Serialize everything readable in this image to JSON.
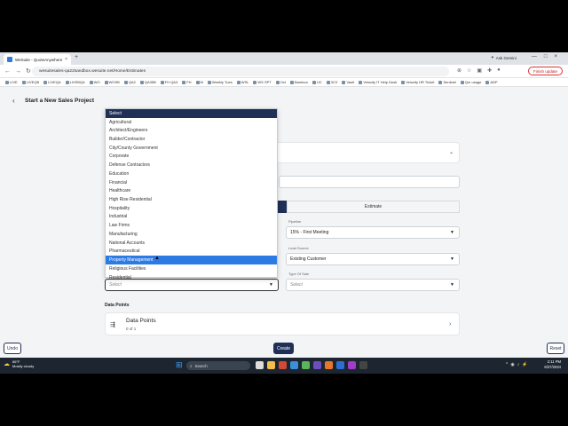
{
  "browser": {
    "tab_title": "WeSuite - QuoteAnywhere",
    "tab_close": "×",
    "new_tab": "+",
    "gemini": "Ask Gemini",
    "url": "wesuitesales-qa22sandbox.wesuite.net/Home/Estimates",
    "finish_update": "Finish update",
    "window_controls": "—□×",
    "nav_icons": "←→↻",
    "bookmarks": [
      "LIVE",
      "LIVEQB",
      "LIVEQA",
      "LIVEBQA",
      "WO",
      "WOSB",
      "QA2",
      "QA35B",
      "FH QA3",
      "FH",
      "M",
      "Weekly Tues",
      "WSL",
      "WS SPT",
      "Oct",
      "Bamboo",
      "UC",
      "3CX",
      "Vault",
      "Velocity IT Help Desk",
      "Velocity HR Ticket",
      "Sentinel",
      "Qm usage",
      "ADP"
    ]
  },
  "app": {
    "page_title": "Start a New Sales Project",
    "back_icon": "‹",
    "tab_estimate": "Estimate",
    "pipeline_label": "Pipeline",
    "pipeline_value": "15% - First Meeting",
    "lead_source_label": "Lead Source",
    "lead_source_value": "Existing Customer",
    "type_of_sale_label": "Type Of Sale",
    "type_of_sale_placeholder": "Select",
    "market_select_placeholder": "Select",
    "dropdown_items": [
      "Select",
      "Agricultural",
      "Architect/Engineers",
      "Builder/Contractor",
      "City/County Government",
      "Corporate",
      "Defense Contractors",
      "Education",
      "Financial",
      "Healthcare",
      "High Rise Residential",
      "Hospitality",
      "Industrial",
      "Law Firms",
      "Manufacturing",
      "National Accounts",
      "Pharmaceutical",
      "Property Management",
      "Religious Facilities",
      "Residential"
    ],
    "selected_index": 17,
    "data_points_section": "Data Points",
    "data_points_title": "Data Points",
    "data_points_count": "0 of 1",
    "buttons": {
      "undo": "Undo",
      "create": "Create",
      "reset": "Reset"
    }
  },
  "taskbar": {
    "temp": "86°F",
    "weather": "Mostly cloudy",
    "search": "Search",
    "time": "2:11 PM",
    "date": "6/27/2024"
  },
  "colors": {
    "accent_navy": "#1f2f56",
    "selected_blue": "#2c7be5"
  }
}
